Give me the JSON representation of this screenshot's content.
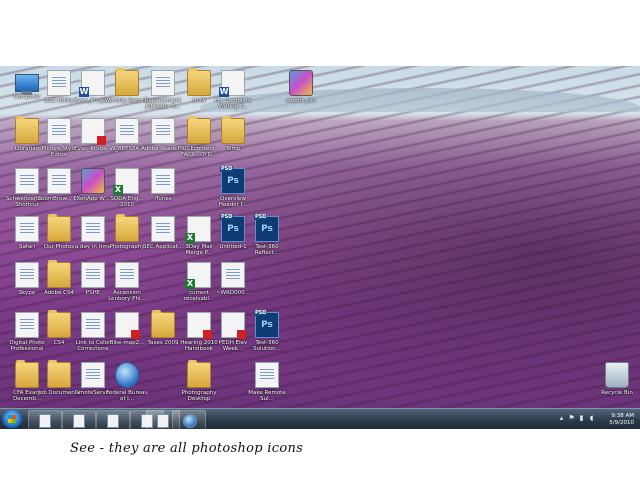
{
  "desktop_icons": [
    {
      "label": "Computer",
      "icon": "computer-icon"
    },
    {
      "label": "DSS Utility",
      "icon": "photoshop-icon"
    },
    {
      "label": "Evan_Kruge...",
      "icon": "word-document-icon"
    },
    {
      "label": "WordUp Reports",
      "icon": "folder-icon"
    },
    {
      "label": "Replacement Jobfolder 5...",
      "icon": "document-icon"
    },
    {
      "label": "UofA",
      "icon": "folder-icon"
    },
    {
      "label": "For Complete Writing P...",
      "icon": "word-document-icon"
    },
    {
      "label": "credits_pro",
      "icon": "app-icon"
    },
    {
      "label": "Librarian",
      "icon": "folder-icon"
    },
    {
      "label": "Picture Style Editor",
      "icon": "photoshop-icon"
    },
    {
      "label": "Evan_Kruge...",
      "icon": "pdf-icon"
    },
    {
      "label": "W_BEPS84...",
      "icon": "document-icon"
    },
    {
      "label": "Adobe Reader 9",
      "icon": "photoshop-icon"
    },
    {
      "label": "PRICEcontent... FACK...OYD...",
      "icon": "folder-icon"
    },
    {
      "label": "Temp",
      "icon": "folder-icon"
    },
    {
      "label": "Schweitzerhe... Shortcut",
      "icon": "photoshop-icon"
    },
    {
      "label": "ZoomBrow... EX",
      "icon": "photoshop-icon"
    },
    {
      "label": "XenApp W...",
      "icon": "app-icon"
    },
    {
      "label": "SODA Eng... 2010",
      "icon": "excel-icon"
    },
    {
      "label": "iTunes",
      "icon": "photoshop-icon"
    },
    {
      "label": "Overview Header f...",
      "icon": "psd-icon"
    },
    {
      "label": "Safari",
      "icon": "photoshop-icon"
    },
    {
      "label": "Our Photos",
      "icon": "folder-icon"
    },
    {
      "label": "a day in time",
      "icon": "photoshop-icon"
    },
    {
      "label": "Photography",
      "icon": "folder-icon"
    },
    {
      "label": "SEC Applicat...",
      "icon": "document-icon"
    },
    {
      "label": "3Day Mail Merge P...",
      "icon": "excel-icon"
    },
    {
      "label": "Untitled-1",
      "icon": "psd-icon"
    },
    {
      "label": "Test-360 Reflect...",
      "icon": "psd-icon"
    },
    {
      "label": "Skype",
      "icon": "photoshop-icon"
    },
    {
      "label": "Adobe CS4",
      "icon": "folder-icon"
    },
    {
      "label": "PSHE",
      "icon": "photoshop-icon"
    },
    {
      "label": "Ascension Lenbory Phi...",
      "icon": "document-icon"
    },
    {
      "label": "current receivabl...",
      "icon": "excel-icon"
    },
    {
      "label": "~WRD000...",
      "icon": "document-icon"
    },
    {
      "label": "Digital Photo Professional",
      "icon": "photoshop-icon"
    },
    {
      "label": "CS4",
      "icon": "folder-icon"
    },
    {
      "label": "Link to Color Corrections",
      "icon": "document-icon"
    },
    {
      "label": "Bike-map2...",
      "icon": "pdf-icon"
    },
    {
      "label": "Taxes 2009",
      "icon": "folder-icon"
    },
    {
      "label": "Hearing 2010 Handbook",
      "icon": "pdf-icon"
    },
    {
      "label": "PEDH Elev Week...",
      "icon": "pdf-icon"
    },
    {
      "label": "Test-360 Solution...",
      "icon": "psd-icon"
    },
    {
      "label": "CFA Exam Decemb...",
      "icon": "folder-icon"
    },
    {
      "label": "Job Documents",
      "icon": "folder-icon"
    },
    {
      "label": "GmoteServer",
      "icon": "photoshop-icon"
    },
    {
      "label": "Federal Bureau of I...",
      "icon": "globe-icon"
    },
    {
      "label": "Photography Desktop",
      "icon": "folder-icon"
    },
    {
      "label": "Make Remote Sui...",
      "icon": "photoshop-icon"
    },
    {
      "label": "Recycle Bin",
      "icon": "recycle-bin-icon"
    }
  ],
  "taskbar": {
    "buttons": [
      "photoshop-icon",
      "photoshop-icon",
      "photoshop-icon",
      "photoshop-icon",
      "photoshop-icon",
      "globe-icon"
    ],
    "clock_time": "9:38 AM",
    "clock_date": "5/9/2010"
  },
  "caption": "See - they are all photoshop icons"
}
